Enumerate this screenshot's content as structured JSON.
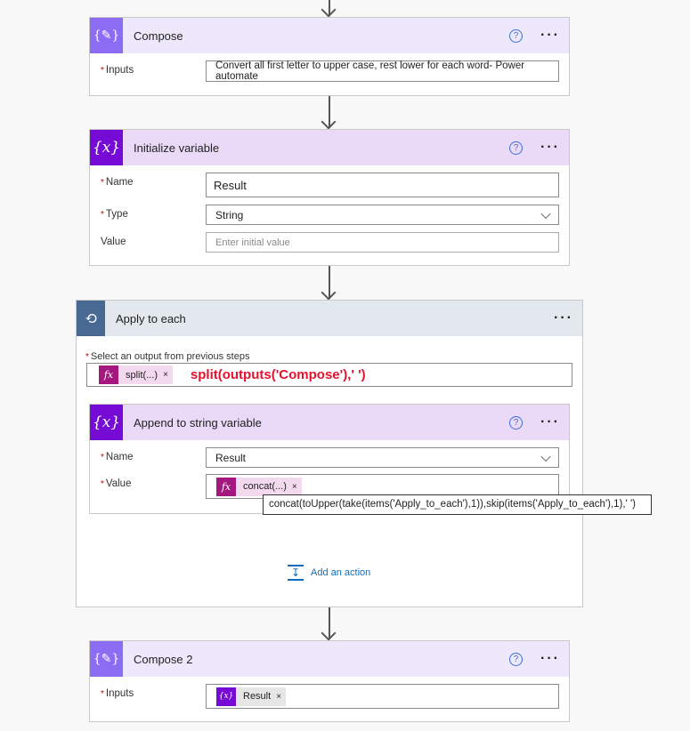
{
  "colors": {
    "compose": "#8c6cf2",
    "compose_header": "#eee8fc",
    "variable": "#770bd6",
    "variable_header": "#eadaf7",
    "loop": "#486991",
    "loop_header": "#e3e7ee",
    "expression": "#a4177f",
    "expression_chip": "#f2d9ee",
    "red": "#e8112d",
    "link": "#0f6cbd"
  },
  "compose": {
    "title": "Compose",
    "icon": "compose-icon",
    "inputs_label": "Inputs",
    "inputs_value": "Convert all first letter to upper case, rest lower for each word- Power automate"
  },
  "init_variable": {
    "title": "Initialize variable",
    "icon": "variable-icon",
    "name_label": "Name",
    "name_value": "Result",
    "type_label": "Type",
    "type_value": "String",
    "value_label": "Value",
    "value_placeholder": "Enter initial value"
  },
  "apply_to_each": {
    "title": "Apply to each",
    "icon": "loop-icon",
    "select_label": "Select an output from previous steps",
    "chip_label": "split(...)",
    "annotation": "split(outputs('Compose'),' ')",
    "add_action": "Add an action"
  },
  "append": {
    "title": "Append to string variable",
    "name_label": "Name",
    "name_value": "Result",
    "value_label": "Value",
    "chip_label": "concat(...)",
    "tooltip": "concat(toUpper(take(items('Apply_to_each'),1)),skip(items('Apply_to_each'),1),' ')"
  },
  "compose2": {
    "title": "Compose 2",
    "inputs_label": "Inputs",
    "chip_label": "Result"
  },
  "common": {
    "help": "?",
    "more": "···",
    "remove": "×",
    "fx": "fx",
    "x": "{x}"
  }
}
